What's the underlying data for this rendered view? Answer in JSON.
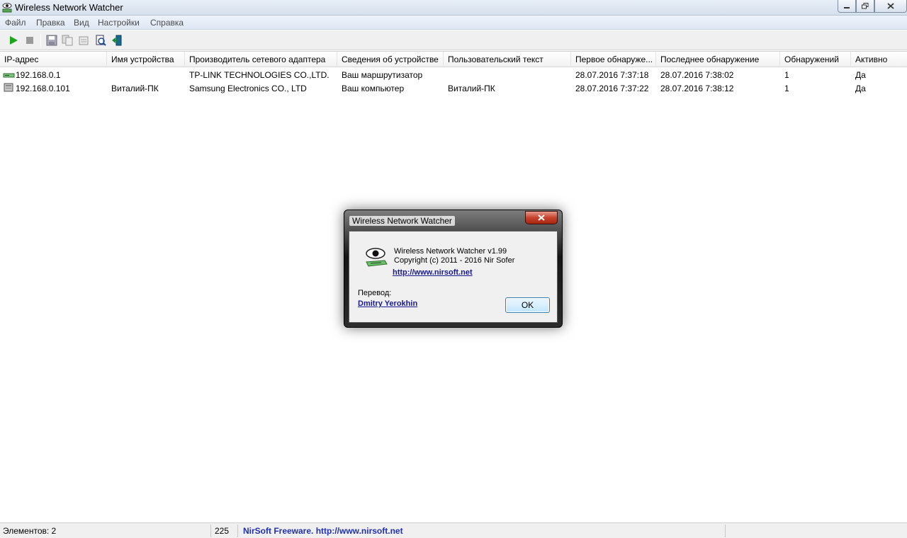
{
  "window": {
    "title": "Wireless Network Watcher"
  },
  "menu": [
    "Файл",
    "Правка",
    "Вид",
    "Настройки",
    "Справка"
  ],
  "toolbar": {
    "icons": [
      "play-icon",
      "stop-icon",
      "save-icon",
      "copy-icon",
      "properties-icon",
      "html-report-icon",
      "exit-icon"
    ]
  },
  "columns": [
    "IP-адрес",
    "Имя устройства",
    "Производитель сетевого адаптера",
    "Сведения об устройстве",
    "Пользовательский текст",
    "Первое обнаруже...",
    "Последнее обнаружение",
    "Обнаружений",
    "Активно"
  ],
  "rows": [
    {
      "ip": "192.168.0.1",
      "device_name": "",
      "vendor": "TP-LINK TECHNOLOGIES CO.,LTD.",
      "info": "Ваш маршрутизатор",
      "user_text": "",
      "first_seen": "28.07.2016 7:37:18",
      "last_seen": "28.07.2016 7:38:02",
      "detections": "1",
      "active": "Да",
      "icon": "router-icon"
    },
    {
      "ip": "192.168.0.101",
      "device_name": "Виталий-ПК",
      "vendor": "Samsung Electronics CO., LTD",
      "info": "Ваш компьютер",
      "user_text": "Виталий-ПК",
      "first_seen": "28.07.2016 7:37:22",
      "last_seen": "28.07.2016 7:38:12",
      "detections": "1",
      "active": "Да",
      "icon": "computer-icon"
    }
  ],
  "status": {
    "items": "Элементов: 2",
    "count": "225",
    "freeware": "NirSoft Freeware.  http://www.nirsoft.net"
  },
  "about_dialog": {
    "title": "Wireless Network Watcher",
    "version": "Wireless Network Watcher v1.99",
    "copyright": "Copyright (c) 2011 - 2016 Nir Sofer",
    "url": "http://www.nirsoft.net",
    "translation_label": "Перевод:",
    "translator": "Dmitry Yerokhin",
    "ok_label": "OK"
  }
}
